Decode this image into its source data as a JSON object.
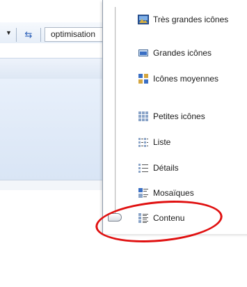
{
  "toolbar": {
    "search_value": "optimisation",
    "dropdown_icon": "chevron-down-icon",
    "refresh_icon": "refresh-arrows-icon"
  },
  "view_menu": {
    "items": [
      {
        "label": "Très grandes icônes",
        "icon": "extra-large-icons-icon"
      },
      {
        "label": "Grandes icônes",
        "icon": "large-icons-icon"
      },
      {
        "label": "Icônes moyennes",
        "icon": "medium-icons-icon"
      },
      {
        "label": "Petites icônes",
        "icon": "small-icons-icon"
      },
      {
        "label": "Liste",
        "icon": "list-view-icon"
      },
      {
        "label": "Détails",
        "icon": "details-view-icon"
      },
      {
        "label": "Mosaïques",
        "icon": "tiles-view-icon"
      },
      {
        "label": "Contenu",
        "icon": "content-view-icon"
      }
    ],
    "selected": "Contenu"
  },
  "colors": {
    "annotation": "#e01010",
    "icon_blue": "#3a6fc4"
  }
}
